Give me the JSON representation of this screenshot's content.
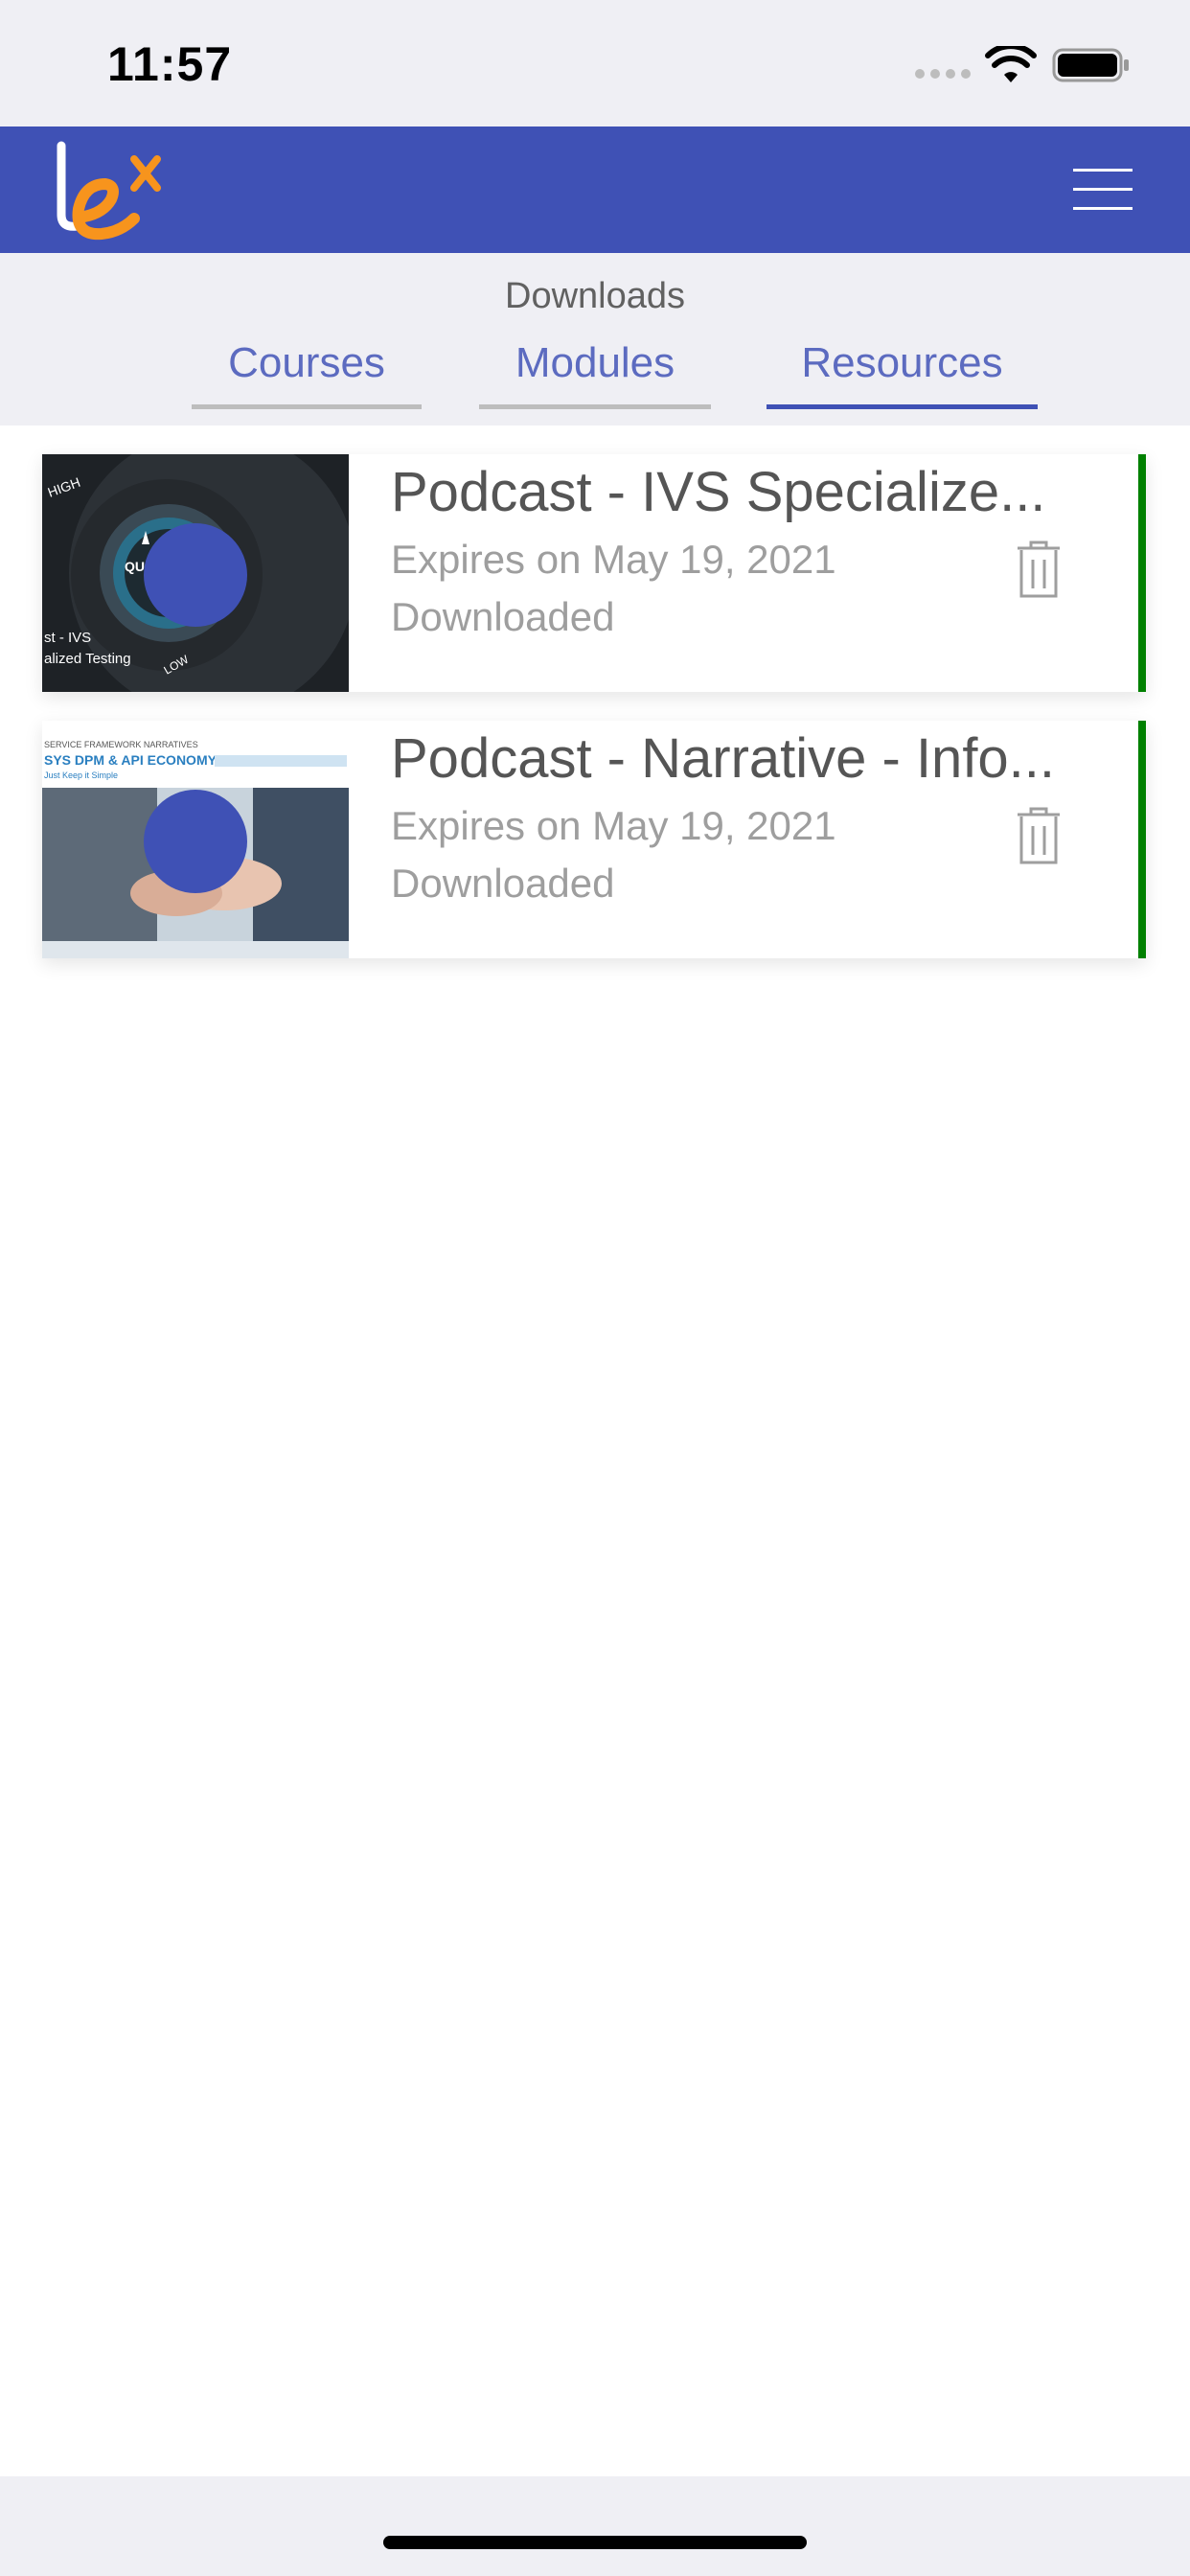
{
  "status_bar": {
    "time": "11:57",
    "icons": [
      "cellular-signal-icon",
      "wifi-icon",
      "battery-icon"
    ]
  },
  "header": {
    "logo_text": "lex",
    "menu_icon": "hamburger-menu-icon",
    "colors": {
      "background": "#3f51b5",
      "logo_orange": "#f7941d",
      "logo_white": "#ffffff"
    }
  },
  "downloads": {
    "title": "Downloads",
    "tabs": [
      {
        "label": "Courses",
        "active": false
      },
      {
        "label": "Modules",
        "active": false
      },
      {
        "label": "Resources",
        "active": true
      }
    ],
    "colors": {
      "tab_text": "#5c6bc0",
      "active_underline": "#3f51b5",
      "inactive_underline": "#bdbdbd"
    }
  },
  "items": [
    {
      "title": "Podcast - IVS Specialize...",
      "expiry": "Expires on May 19, 2021",
      "status": "Downloaded",
      "thumbnail_text": [
        "HIGH",
        "QU",
        "st - IVS",
        "alized Testing",
        "LOW"
      ],
      "delete_icon": "trash-icon"
    },
    {
      "title": "Podcast - Narrative - Info...",
      "expiry": "Expires on May 19, 2021",
      "status": "Downloaded",
      "thumbnail_text": [
        "SERVICE FRAMEWORK NARRATIVES",
        "SYS DPM & API ECONOMY",
        "Just Keep it Simple"
      ],
      "delete_icon": "trash-icon"
    }
  ],
  "colors": {
    "downloaded_accent": "#008000",
    "thumbnail_dot": "#3f51b5"
  }
}
